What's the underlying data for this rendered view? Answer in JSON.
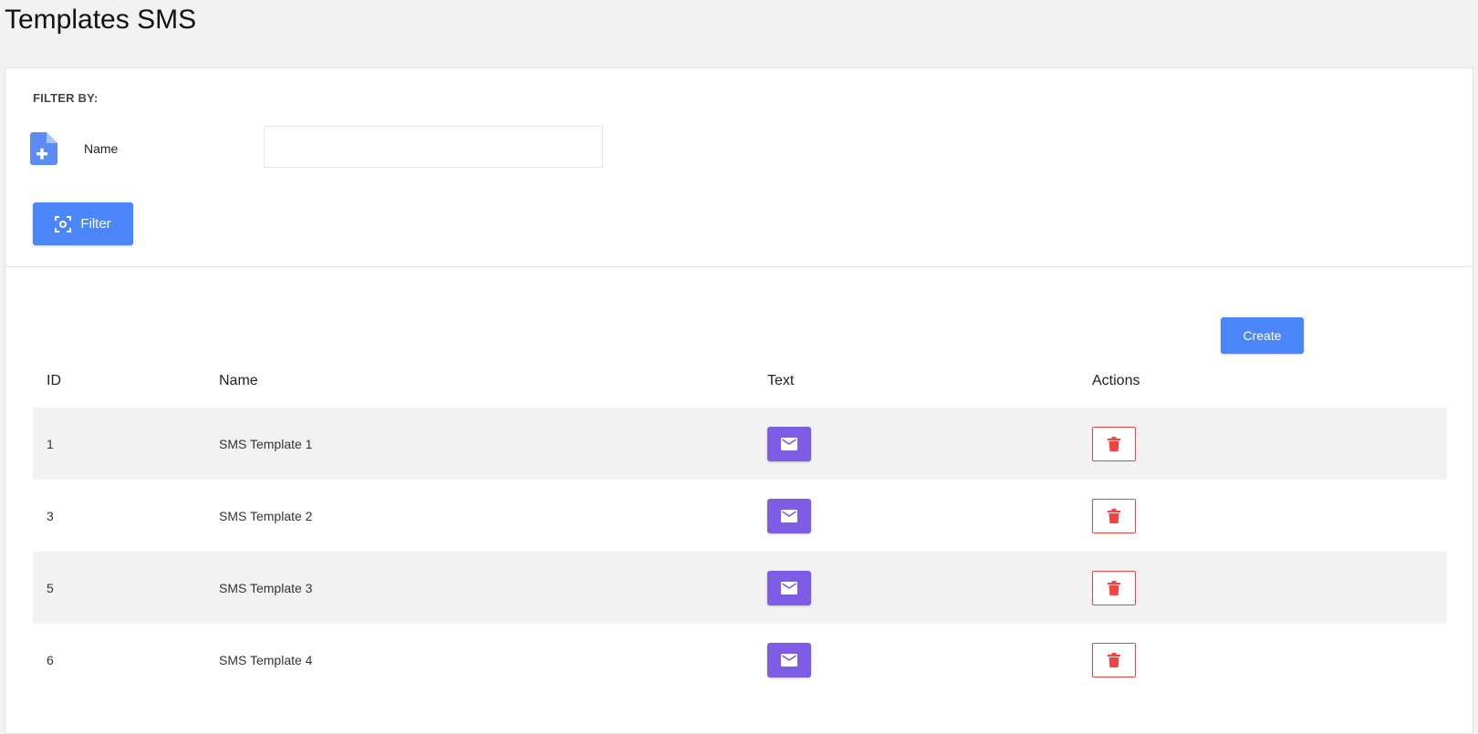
{
  "page": {
    "title": "Templates SMS"
  },
  "filter": {
    "heading": "FILTER BY:",
    "name_label": "Name",
    "name_value": "",
    "name_placeholder": "",
    "button_label": "Filter"
  },
  "list": {
    "create_label": "Create",
    "columns": {
      "id": "ID",
      "name": "Name",
      "text": "Text",
      "actions": "Actions"
    },
    "rows": [
      {
        "id": "1",
        "name": "SMS Template 1"
      },
      {
        "id": "3",
        "name": "SMS Template 2"
      },
      {
        "id": "5",
        "name": "SMS Template 3"
      },
      {
        "id": "6",
        "name": "SMS Template 4"
      }
    ]
  },
  "icons": {
    "filter_icon": "focus-frame-icon",
    "file_icon": "file-add-icon",
    "text_icon": "envelope-icon",
    "delete_icon": "trash-icon"
  },
  "colors": {
    "primary": "#4a86f7",
    "text_button": "#7f5ce6",
    "danger": "#ef4444",
    "page_bg": "#f2f2f2",
    "row_alt": "#f2f2f2"
  }
}
